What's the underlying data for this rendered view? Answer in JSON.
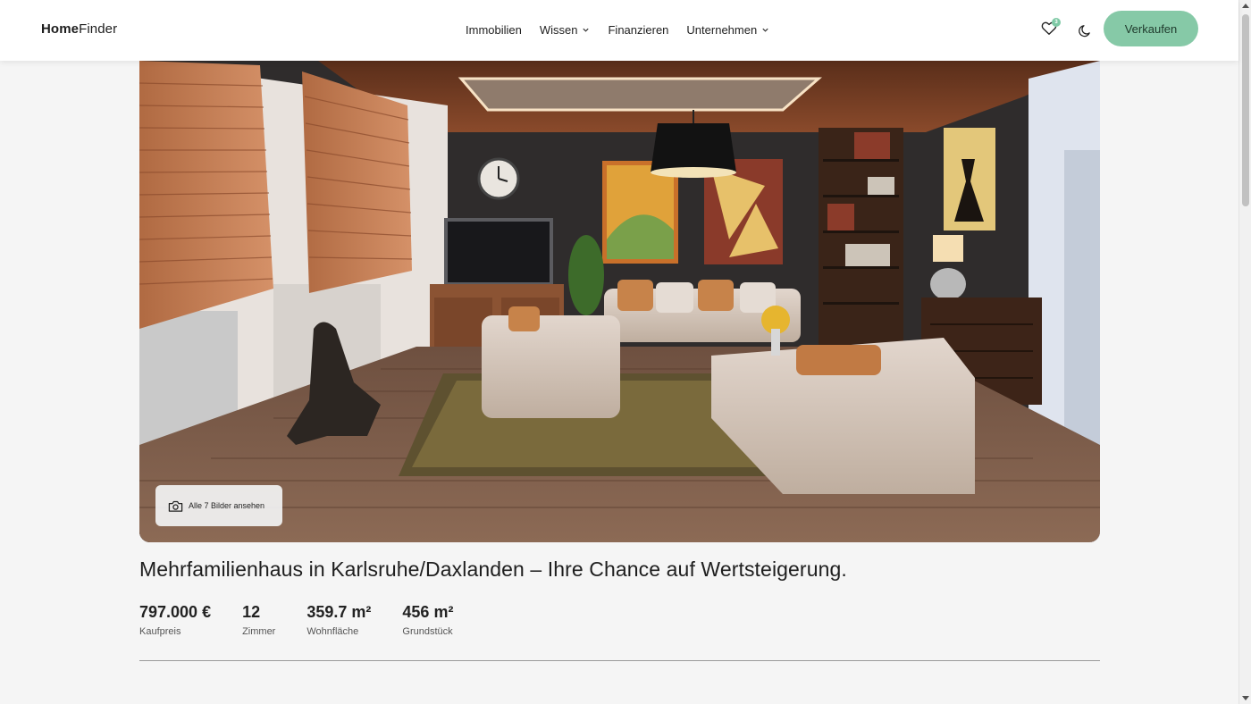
{
  "header": {
    "logo_bold": "Home",
    "logo_light": "Finder",
    "nav": [
      {
        "label": "Immobilien",
        "dropdown": false
      },
      {
        "label": "Wissen",
        "dropdown": true
      },
      {
        "label": "Finanzieren",
        "dropdown": false
      },
      {
        "label": "Unternehmen",
        "dropdown": true
      }
    ],
    "favorites_count": "3",
    "sell_label": "Verkaufen",
    "accent_color": "#86c9a7"
  },
  "hero": {
    "gallery_label": "Alle 7 Bilder ansehen",
    "icon": "camera-icon"
  },
  "listing": {
    "title": "Mehrfamilienhaus in Karlsruhe/Daxlanden – Ihre Chance auf Wertsteigerung.",
    "facts": [
      {
        "value": "797.000 €",
        "label": "Kaufpreis"
      },
      {
        "value": "12",
        "label": "Zimmer"
      },
      {
        "value": "359.7 m²",
        "label": "Wohnfläche"
      },
      {
        "value": "456 m²",
        "label": "Grundstück"
      }
    ]
  }
}
